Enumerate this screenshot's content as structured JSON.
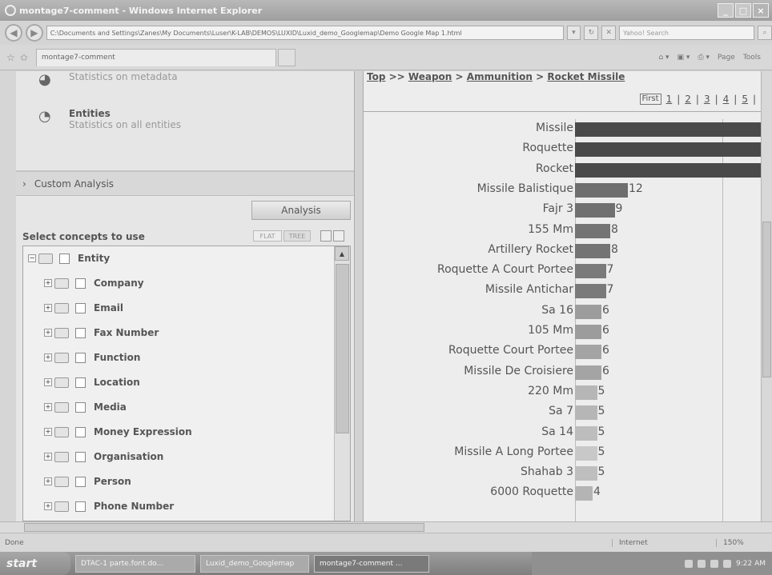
{
  "window": {
    "title": "montage7-comment - Windows Internet Explorer",
    "address": "C:\\Documents and Settings\\Zanes\\My Documents\\Luser\\K-LAB\\DEMOS\\LUXID\\Luxid_demo_Googlemap\\Demo Google Map 1.html",
    "search_placeholder": "Yahoo! Search",
    "tab_title": "montage7-comment",
    "cmd_page": "Page",
    "cmd_tools": "Tools"
  },
  "left": {
    "stat_metadata_desc": "Statistics on metadata",
    "stat_entities_title": "Entities",
    "stat_entities_desc": "Statistics on all entities",
    "custom_analysis": "Custom Analysis",
    "analysis_button": "Analysis",
    "select_label": "Select concepts to use",
    "flat_label": "FLAT",
    "tree_label": "TREE",
    "tree_root": "Entity",
    "tree_items": [
      "Company",
      "Email",
      "Fax Number",
      "Function",
      "Location",
      "Media",
      "Money Expression",
      "Organisation",
      "Person",
      "Phone Number"
    ]
  },
  "right": {
    "breadcrumb": [
      "Top",
      "Weapon",
      "Ammunition",
      "Rocket Missile"
    ],
    "breadcrumb_sep": ">>",
    "pager": [
      "First",
      "1",
      "2",
      "3",
      "4",
      "5"
    ]
  },
  "chart_data": {
    "type": "bar",
    "orientation": "horizontal",
    "categories": [
      "Missile",
      "Roquette",
      "Rocket",
      "Missile Balistique",
      "Fajr 3",
      "155 Mm",
      "Artillery Rocket",
      "Roquette A Court Portee",
      "Missile Antichar",
      "Sa 16",
      "105 Mm",
      "Roquette Court Portee",
      "Missile De Croisiere",
      "220 Mm",
      "Sa 7",
      "Sa 14",
      "Missile A Long Portee",
      "Shahab 3",
      "6000 Roquette"
    ],
    "values": [
      null,
      null,
      null,
      12,
      9,
      8,
      8,
      7,
      7,
      6,
      6,
      6,
      6,
      5,
      5,
      5,
      5,
      5,
      4
    ],
    "value_labels": [
      "",
      "",
      "",
      "12",
      "9",
      "8",
      "8",
      "7",
      "7",
      "6",
      "6",
      "6",
      "6",
      "5",
      "5",
      "5",
      "5",
      "5",
      "4"
    ],
    "overflow_bars": [
      0,
      1,
      2
    ],
    "bar_colors": [
      "#4a4a4a",
      "#4a4a4a",
      "#4a4a4a",
      "#6e6e6e",
      "#707070",
      "#747474",
      "#747474",
      "#7a7a7a",
      "#7a7a7a",
      "#9c9c9c",
      "#9c9c9c",
      "#a4a4a4",
      "#a4a4a4",
      "#b6b6b6",
      "#b6b6b6",
      "#bdbdbd",
      "#c8c8c8",
      "#bebebe",
      "#b4b4b4"
    ]
  },
  "status": {
    "text": "Done",
    "zone": "Internet",
    "zoom": "150%"
  },
  "taskbar": {
    "start": "start",
    "tasks": [
      "DTAC-1 parte.font.do...",
      "Luxid_demo_Googlemap",
      "montage7-comment ..."
    ],
    "clock": "9:22 AM"
  }
}
